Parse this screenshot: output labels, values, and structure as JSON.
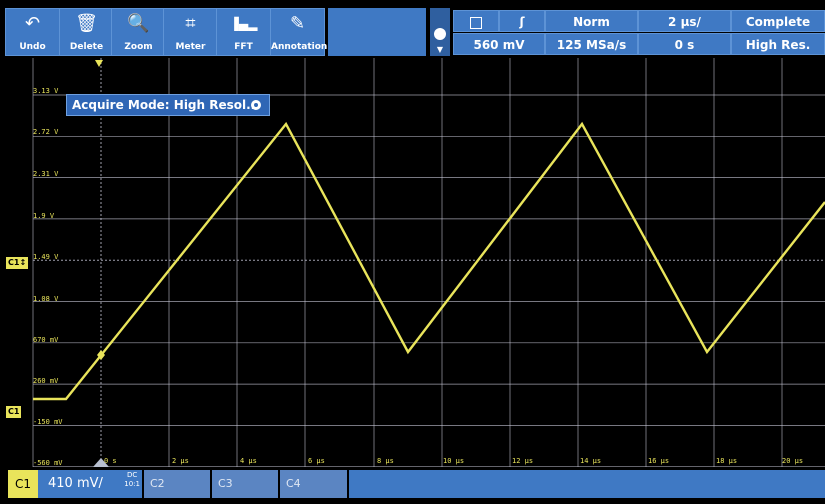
{
  "toolbar": {
    "buttons": [
      {
        "label": "Undo",
        "icon": "undo-arrow-icon"
      },
      {
        "label": "Delete",
        "icon": "trash-icon"
      },
      {
        "label": "Zoom",
        "icon": "zoom-icon"
      },
      {
        "label": "Meter",
        "icon": "meter-icon"
      },
      {
        "label": "FFT",
        "icon": "fft-icon"
      },
      {
        "label": "Annotation",
        "icon": "pencil-icon"
      }
    ]
  },
  "status": {
    "trigger_slope": "ʃ",
    "trigger_mode": "Norm",
    "timebase": "2 µs/",
    "acq_state": "Complete",
    "trigger_level": "560 mV",
    "sample_rate": "125 MSa/s",
    "delay": "0 s",
    "acq_mode": "High Res."
  },
  "popup": {
    "text": "Acquire Mode: High Resol..."
  },
  "axis": {
    "volt_labels": [
      "3.13 V",
      "2.72 V",
      "2.31 V",
      "1.9 V",
      "1.49 V",
      "1.08 V",
      "670 mV",
      "260 mV",
      "-150 mV",
      "-560 mV"
    ],
    "time_labels": [
      "0 s",
      "2 µs",
      "4 µs",
      "6 µs",
      "8 µs",
      "10 µs",
      "12 µs",
      "14 µs",
      "16 µs",
      "18 µs",
      "20 µs"
    ]
  },
  "markers": {
    "c1_offset": "C1↕",
    "c1_ground": "C1"
  },
  "channels": {
    "c1_label": "C1",
    "c1_scale": "410 mV/",
    "c1_coupling": "DC",
    "c1_probe": "10:1",
    "c2_label": "C2",
    "c3_label": "C3",
    "c4_label": "C4"
  },
  "colors": {
    "trace": "#e9e45b",
    "accent": "#3f79c4",
    "grid": "#c8c8d8"
  }
}
